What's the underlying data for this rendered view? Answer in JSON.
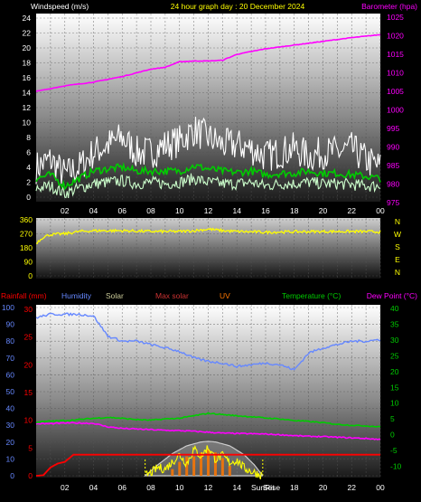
{
  "colors": {
    "wind": "#ffffff",
    "gust": "#ffffff",
    "avg": "#00cc00",
    "min": "#ccffcc",
    "barometer": "#ff00ff",
    "wind_dir": "#ffff00",
    "rainfall": "#ff0000",
    "humidity": "#6688ff",
    "solar": "#ffff00",
    "max_solar": "#cccccc",
    "uv": "#ff7700",
    "temperature": "#00cc00",
    "dew_point": "#ff00ff",
    "compass": "#ffff00",
    "sunrise_marker": "#ffff00"
  },
  "chart_data": [
    {
      "type": "line",
      "title": "24 hour graph day : 20 December 2024",
      "series_labels": {
        "windspeed": "Windspeed (m/s)",
        "barometer": "Barometer (hpa)"
      },
      "x_ticks": [
        "02",
        "04",
        "06",
        "08",
        "10",
        "12",
        "14",
        "16",
        "18",
        "20",
        "22",
        "00"
      ],
      "xlim": [
        0,
        24
      ],
      "y_left": {
        "ticks": [
          0,
          2,
          4,
          6,
          8,
          10,
          12,
          14,
          16,
          18,
          20,
          22,
          24
        ],
        "ylim": [
          0,
          24
        ]
      },
      "y_right": {
        "ticks": [
          975,
          980,
          985,
          990,
          995,
          1000,
          1005,
          1010,
          1015,
          1020,
          1025
        ],
        "ylim": [
          974,
          1026
        ]
      },
      "series": {
        "barometer": {
          "x": [
            0,
            2,
            4,
            6,
            8,
            9,
            10,
            11,
            12,
            13,
            14,
            16,
            18,
            20,
            22,
            24
          ],
          "y": [
            1005,
            1006.5,
            1007.5,
            1009,
            1011,
            1011.5,
            1013,
            1013.2,
            1013.2,
            1013.4,
            1015,
            1016.5,
            1017.5,
            1018.5,
            1019.5,
            1020.3
          ]
        },
        "wind_gust": {
          "x": [
            0,
            1,
            2,
            3,
            4,
            5,
            6,
            7,
            8,
            9,
            10,
            11,
            12,
            13,
            14,
            15,
            16,
            17,
            18,
            19,
            20,
            21,
            22,
            23,
            24
          ],
          "y": [
            4,
            5,
            3,
            4,
            6,
            7,
            8,
            6,
            6,
            7,
            7.5,
            9,
            8,
            7,
            7,
            6.5,
            5.5,
            6,
            6.5,
            5.5,
            6,
            6,
            6.5,
            5,
            4
          ]
        },
        "wind_avg": {
          "x": [
            0,
            1,
            2,
            3,
            4,
            5,
            6,
            7,
            8,
            9,
            10,
            11,
            12,
            13,
            14,
            15,
            16,
            17,
            18,
            19,
            20,
            21,
            22,
            23,
            24
          ],
          "y": [
            2.5,
            3,
            1.5,
            2.5,
            3.5,
            3.8,
            4,
            3.5,
            3.5,
            3.5,
            3.5,
            4.2,
            3.8,
            3.5,
            3.3,
            3.5,
            3,
            3.2,
            3.2,
            3.5,
            3.2,
            3.2,
            3,
            2.8,
            2.5
          ]
        },
        "wind_min": {
          "x": [
            0,
            1,
            2,
            3,
            4,
            5,
            6,
            7,
            8,
            9,
            10,
            11,
            12,
            13,
            14,
            15,
            16,
            17,
            18,
            19,
            20,
            21,
            22,
            23,
            24
          ],
          "y": [
            1.2,
            1.5,
            0.5,
            1.2,
            1.8,
            2,
            2.2,
            1.8,
            2,
            1.8,
            2,
            2.5,
            2,
            1.8,
            1.8,
            2,
            1.5,
            1.8,
            1.8,
            2,
            1.8,
            1.8,
            1.7,
            1.5,
            1.5
          ]
        }
      }
    },
    {
      "type": "scatter",
      "xlim": [
        0,
        24
      ],
      "y_ticks": [
        0,
        90,
        180,
        270,
        360
      ],
      "ylim": [
        0,
        360
      ],
      "compass_labels": [
        "N",
        "W",
        "S",
        "E",
        "N"
      ],
      "series": {
        "wind_direction": {
          "x": [
            0,
            0.5,
            1,
            2,
            3,
            4,
            6,
            8,
            10,
            11,
            12,
            13,
            14,
            16,
            18,
            20,
            22,
            24
          ],
          "y": [
            210,
            250,
            265,
            270,
            285,
            290,
            290,
            285,
            285,
            290,
            300,
            290,
            285,
            280,
            283,
            285,
            285,
            283
          ]
        }
      }
    },
    {
      "type": "line",
      "series_labels": {
        "rainfall": "Rainfall (mm)",
        "humidity": "Humidity",
        "solar": "Solar",
        "max_solar": "Max solar",
        "uv": "UV",
        "temperature": "Temperature (°C)",
        "dew_point": "Dew Point (°C)"
      },
      "x_ticks": [
        "02",
        "04",
        "06",
        "08",
        "10",
        "12",
        "14",
        "16",
        "18",
        "20",
        "22",
        "00"
      ],
      "sunrise_label": "SunRise",
      "sunset_label": "Set",
      "sunrise_x": 7.6,
      "sunset_x": 15.8,
      "xlim": [
        0,
        24
      ],
      "y_humidity": {
        "ticks": [
          0,
          10,
          20,
          30,
          40,
          50,
          60,
          70,
          80,
          90,
          100
        ],
        "ylim": [
          0,
          100
        ]
      },
      "y_rainfall": {
        "ticks": [
          0,
          5,
          10,
          15,
          20,
          25,
          30
        ],
        "ylim": [
          0,
          30
        ]
      },
      "y_temperature": {
        "ticks": [
          -10,
          -5,
          0,
          5,
          10,
          15,
          20,
          25,
          30,
          35,
          40
        ],
        "ylim": [
          -13,
          40
        ]
      },
      "series": {
        "humidity": {
          "x": [
            0,
            1,
            2,
            3,
            4,
            5,
            6,
            7,
            8,
            9,
            10,
            11,
            12,
            13,
            14,
            15,
            16,
            17,
            18,
            19,
            20,
            21,
            22,
            23,
            24
          ],
          "y": [
            94,
            96,
            96,
            96,
            95,
            83,
            80,
            80,
            78,
            76,
            74,
            70,
            68,
            67,
            65,
            66,
            67,
            66,
            63,
            73,
            76,
            78,
            80,
            80,
            81
          ]
        },
        "temperature": {
          "x": [
            0,
            1,
            2,
            3,
            4,
            5,
            6,
            7,
            8,
            9,
            10,
            11,
            12,
            13,
            14,
            15,
            16,
            17,
            18,
            19,
            20,
            21,
            22,
            23,
            24
          ],
          "y": [
            4,
            4.3,
            4.5,
            4.8,
            5.2,
            5.5,
            5.2,
            4.8,
            4.6,
            5,
            5.2,
            6,
            6.8,
            6.4,
            6,
            5.7,
            5.3,
            5,
            4.5,
            4.2,
            3.8,
            3.3,
            3,
            2.8,
            2.5
          ]
        },
        "dew_point": {
          "x": [
            0,
            1,
            2,
            3,
            4,
            5,
            6,
            7,
            8,
            9,
            10,
            11,
            12,
            13,
            14,
            15,
            16,
            17,
            18,
            19,
            20,
            21,
            22,
            23,
            24
          ],
          "y": [
            3.5,
            3.5,
            3.7,
            3.7,
            3.6,
            2.5,
            2,
            1.8,
            1.6,
            1.4,
            1.3,
            1.1,
            0.8,
            0.5,
            0.4,
            0.3,
            0.2,
            0,
            -0.3,
            -0.5,
            -0.6,
            -0.8,
            -1,
            -1.2,
            -1.5
          ]
        },
        "rainfall": {
          "x": [
            0,
            0.5,
            1,
            1.5,
            2,
            2.6,
            3,
            24
          ],
          "y": [
            0,
            0.1,
            1.5,
            2.2,
            2.5,
            3.8,
            3.8,
            3.8
          ]
        },
        "max_solar": {
          "x": [
            7.6,
            8.5,
            9.5,
            10.5,
            11.5,
            12,
            12.5,
            13.5,
            14.5,
            15.2,
            15.8
          ],
          "y": [
            0,
            2.0,
            4.0,
            5.4,
            6.1,
            6.2,
            6.1,
            5.4,
            3.8,
            2.0,
            0
          ]
        },
        "solar": {
          "x": [
            7.6,
            8,
            8.5,
            9,
            9.5,
            10,
            10.5,
            11,
            11.5,
            12,
            12.5,
            13,
            13.5,
            14,
            14.5,
            15,
            15.8
          ],
          "y": [
            0,
            0.5,
            1.5,
            1.2,
            2.5,
            3.8,
            2.2,
            4.8,
            3.5,
            5.2,
            3,
            3.6,
            2.4,
            2.8,
            1.4,
            0.8,
            0
          ]
        },
        "uv": {
          "x": [
            9.5,
            10,
            10.5,
            11,
            11.5,
            12,
            12.5,
            13,
            13.5
          ],
          "y": [
            1.2,
            2.5,
            3.5,
            3.5,
            4.2,
            4.8,
            4.2,
            3.2,
            1.8
          ]
        }
      }
    }
  ]
}
